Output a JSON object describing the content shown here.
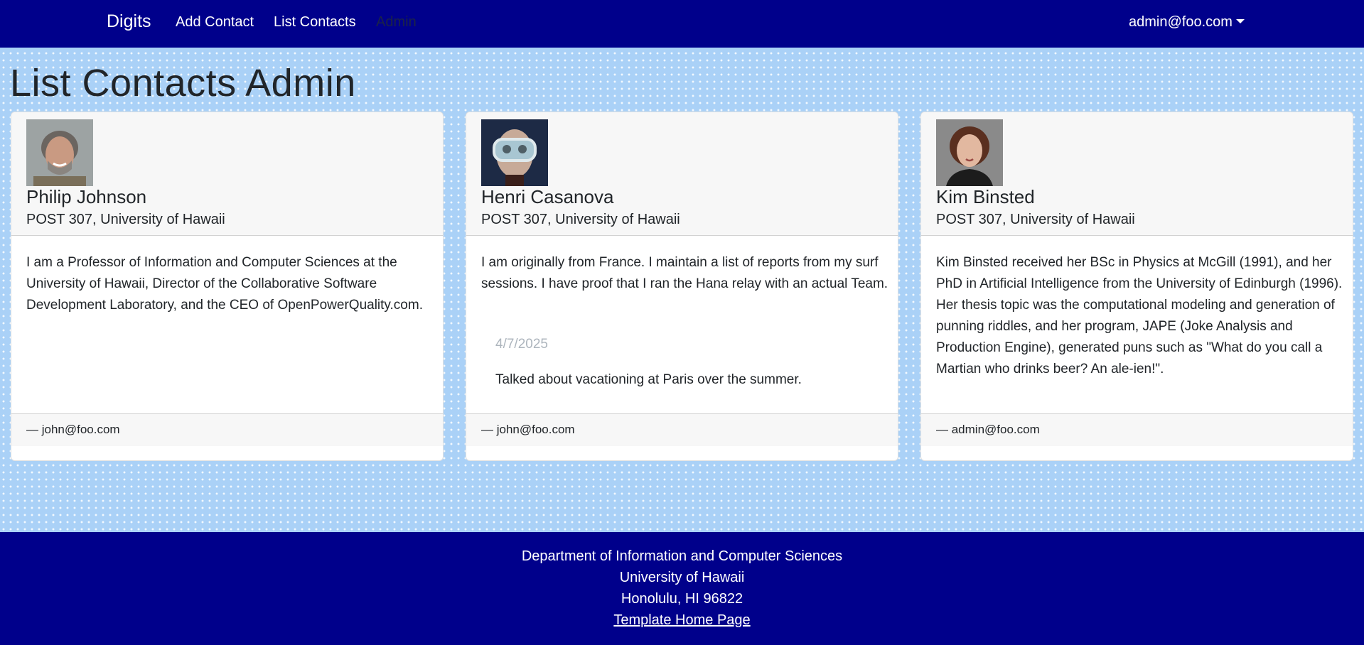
{
  "navbar": {
    "brand": "Digits",
    "links": [
      {
        "label": "Add Contact"
      },
      {
        "label": "List Contacts"
      },
      {
        "label": "Admin"
      }
    ],
    "user": "admin@foo.com",
    "bg_color": "#00008b"
  },
  "page": {
    "title": "List Contacts Admin",
    "background_color": "#aad1f7"
  },
  "contacts": [
    {
      "name": "Philip Johnson",
      "address": "POST 307, University of Hawaii",
      "description": "I am a Professor of Information and Computer Sciences at the University of Hawaii, Director of the Collaborative Software Development Laboratory, and the CEO of OpenPowerQuality.com.",
      "owner": "— john@foo.com",
      "notes": []
    },
    {
      "name": "Henri Casanova",
      "address": "POST 307, University of Hawaii",
      "description": "I am originally from France. I maintain a list of reports from my surf sessions. I have proof that I ran the Hana relay with an actual Team.",
      "owner": "— john@foo.com",
      "notes": [
        {
          "date": "4/7/2025",
          "text": "Talked about vacationing at Paris over the summer."
        }
      ]
    },
    {
      "name": "Kim Binsted",
      "address": "POST 307, University of Hawaii",
      "description": "Kim Binsted received her BSc in Physics at McGill (1991), and her PhD in Artificial Intelligence from the University of Edinburgh (1996). Her thesis topic was the computational modeling and generation of punning riddles, and her program, JAPE (Joke Analysis and Production Engine), generated puns such as \"What do you call a Martian who drinks beer? An ale-ien!\".",
      "owner": "— admin@foo.com",
      "notes": []
    }
  ],
  "footer": {
    "line1": "Department of Information and Computer Sciences",
    "line2": "University of Hawaii",
    "line3": "Honolulu, HI 96822",
    "link": "Template Home Page"
  }
}
